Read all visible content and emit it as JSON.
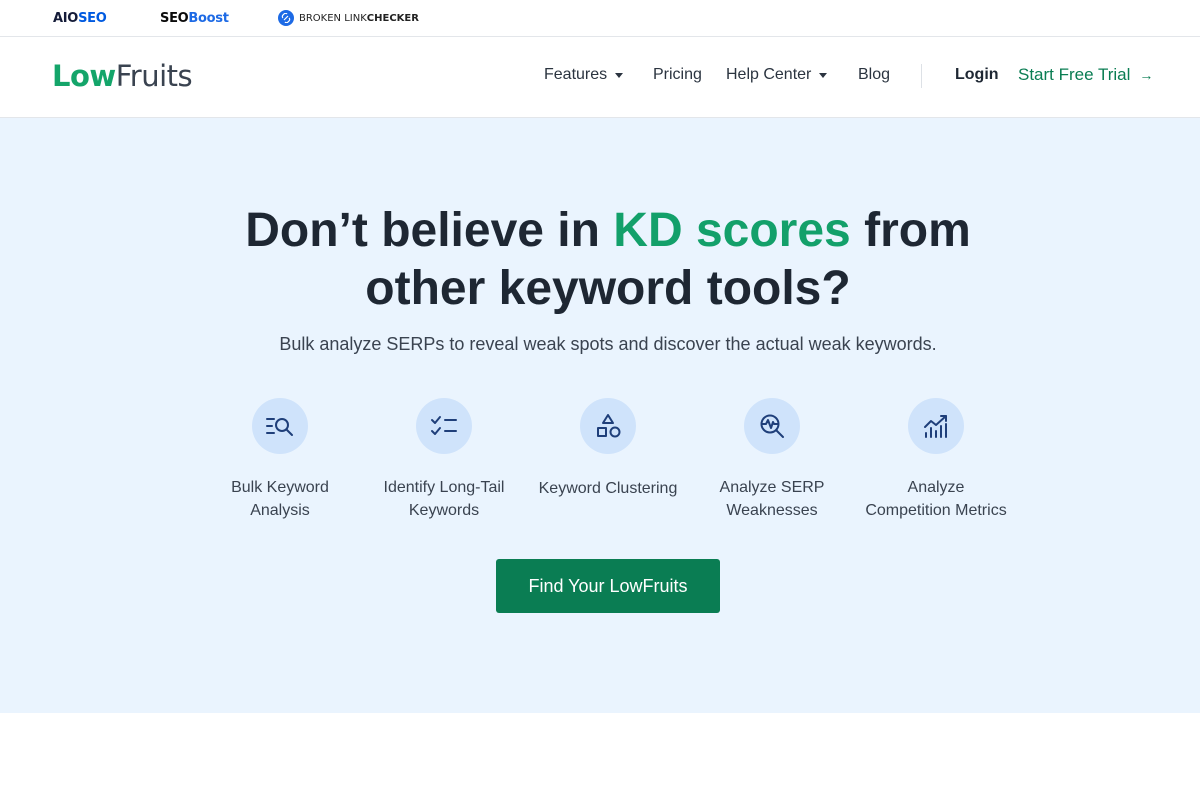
{
  "brands": {
    "aioseo": {
      "part1": "AIO",
      "part2": "SEO"
    },
    "seoboost": {
      "part1": "SEO",
      "part2": "Boost"
    },
    "blc": {
      "part1": "BROKEN LINK ",
      "part2": "CHECKER"
    }
  },
  "logo": {
    "part1": "Low",
    "part2": "Fruits"
  },
  "nav": {
    "features": "Features",
    "pricing": "Pricing",
    "help_center": "Help Center",
    "blog": "Blog",
    "login": "Login",
    "trial": "Start Free Trial",
    "trial_arrow": "→"
  },
  "hero": {
    "headline_pre": "Don’t believe in ",
    "headline_accent": "KD scores",
    "headline_mid": " from",
    "headline_line2": "other keyword tools?",
    "subheadline": "Bulk analyze SERPs to reveal weak spots and discover the actual weak keywords.",
    "cta": "Find Your LowFruits"
  },
  "features": [
    {
      "line1": "Bulk Keyword",
      "line2": "Analysis",
      "icon": "bulk-search-icon"
    },
    {
      "line1": "Identify Long-Tail",
      "line2": "Keywords",
      "icon": "checklist-icon"
    },
    {
      "line1": "Keyword Clustering",
      "line2": "",
      "icon": "shapes-icon"
    },
    {
      "line1": "Analyze SERP",
      "line2": "Weaknesses",
      "icon": "pulse-search-icon"
    },
    {
      "line1": "Analyze",
      "line2": "Competition Metrics",
      "icon": "chart-trend-icon"
    }
  ],
  "colors": {
    "accent_green": "#13a06a",
    "cta_green": "#0a7d53",
    "hero_bg": "#eaf4fe",
    "icon_circle": "#cfe3fb",
    "icon_stroke": "#1f3f7a"
  }
}
